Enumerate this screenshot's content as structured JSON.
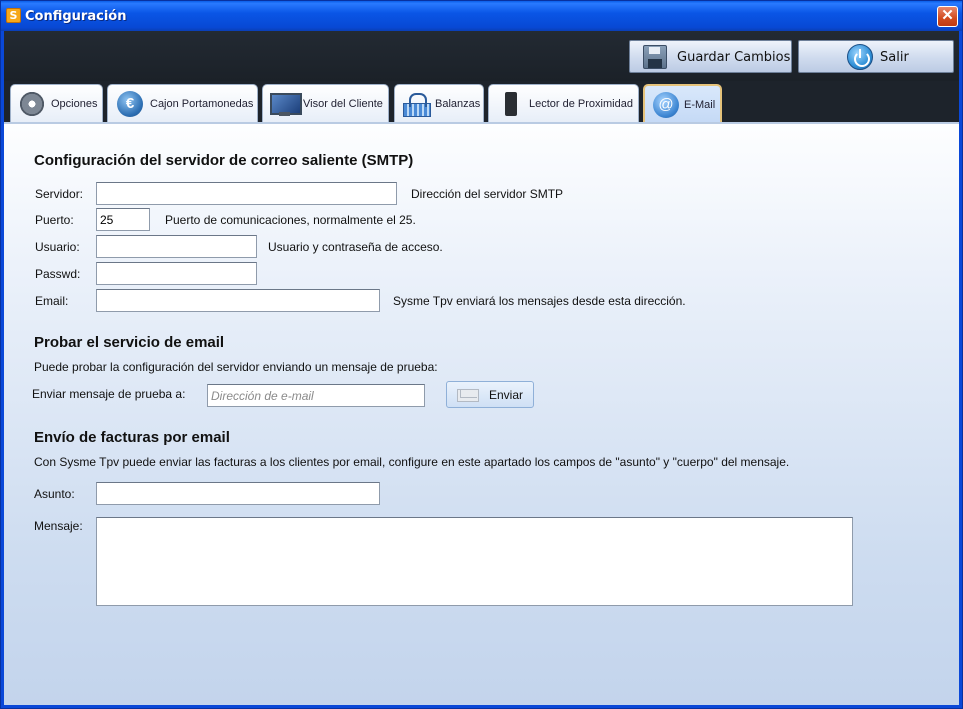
{
  "window": {
    "app_icon_letter": "S",
    "title": "Configuración",
    "close_glyph": "✕"
  },
  "toolbar": {
    "save_label": "Guardar Cambios",
    "exit_label": "Salir",
    "save_icon": "floppy-disk-icon",
    "exit_icon": "power-icon"
  },
  "tabs": [
    {
      "label": "Opciones",
      "icon": "gear-icon",
      "active": false
    },
    {
      "label": "Cajon Portamonedas",
      "icon": "euro-icon",
      "active": false
    },
    {
      "label": "Visor del Cliente",
      "icon": "monitor-icon",
      "active": false
    },
    {
      "label": "Balanzas",
      "icon": "basket-icon",
      "active": false
    },
    {
      "label": "Lector de Proximidad",
      "icon": "chip-icon",
      "active": false
    },
    {
      "label": "E-Mail",
      "icon": "at-icon",
      "active": true
    }
  ],
  "tab_icon_glyphs": {
    "euro": "€",
    "at": "@"
  },
  "smtp": {
    "heading": "Configuración del servidor de correo saliente (SMTP)",
    "server_label": "Servidor:",
    "server_value": "",
    "server_hint": "Dirección del servidor SMTP",
    "port_label": "Puerto:",
    "port_value": "25",
    "port_hint": "Puerto de comunicaciones, normalmente el 25.",
    "user_label": "Usuario:",
    "user_value": "",
    "user_hint": "Usuario y contraseña de acceso.",
    "pass_label": "Passwd:",
    "pass_value": "",
    "email_label": "Email:",
    "email_value": "",
    "email_hint": "Sysme Tpv enviará los mensajes desde esta dirección."
  },
  "test": {
    "heading": "Probar el servicio de email",
    "description": "Puede probar la configuración del servidor enviando un mensaje de prueba:",
    "send_to_label": "Enviar mensaje de prueba a:",
    "send_to_placeholder": "Dirección de e-mail",
    "send_button": "Enviar"
  },
  "invoices": {
    "heading": "Envío de facturas por email",
    "description": "Con Sysme Tpv puede enviar las facturas a los clientes por email, configure en este apartado los campos de \"asunto\" y \"cuerpo\" del mensaje.",
    "subject_label": "Asunto:",
    "subject_value": "",
    "message_label": "Mensaje:",
    "message_value": ""
  }
}
